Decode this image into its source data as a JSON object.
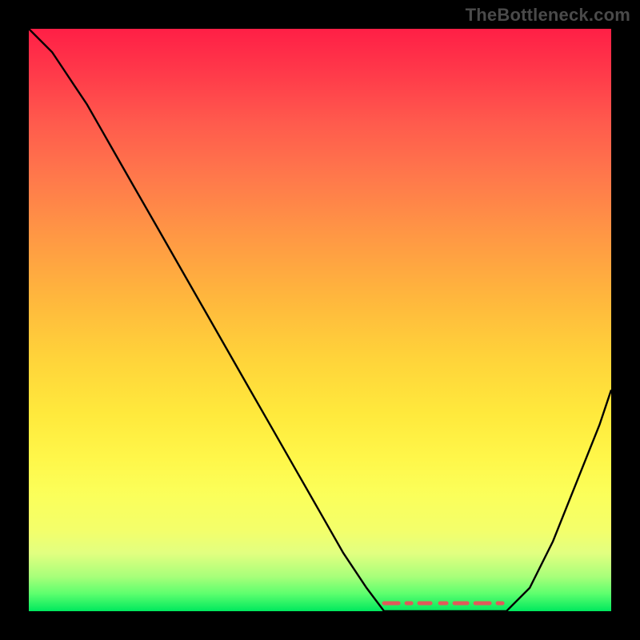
{
  "watermark": "TheBottleneck.com",
  "colors": {
    "page_bg": "#000000",
    "curve": "#000000",
    "dash": "#e05a5a",
    "gradient_top": "#ff1f46",
    "gradient_bottom": "#00e85e"
  },
  "chart_data": {
    "type": "line",
    "title": "",
    "xlabel": "",
    "ylabel": "",
    "xlim": [
      0,
      1
    ],
    "ylim": [
      0,
      1
    ],
    "x": [
      0.0,
      0.02,
      0.04,
      0.06,
      0.08,
      0.1,
      0.14,
      0.18,
      0.22,
      0.26,
      0.3,
      0.34,
      0.38,
      0.42,
      0.46,
      0.5,
      0.54,
      0.58,
      0.61,
      0.66,
      0.7,
      0.74,
      0.78,
      0.82,
      0.86,
      0.9,
      0.94,
      0.98,
      1.0
    ],
    "values": [
      1.0,
      0.98,
      0.96,
      0.93,
      0.9,
      0.87,
      0.8,
      0.73,
      0.66,
      0.59,
      0.52,
      0.45,
      0.38,
      0.31,
      0.24,
      0.17,
      0.1,
      0.04,
      0.0,
      0.0,
      0.0,
      0.0,
      0.0,
      0.0,
      0.04,
      0.12,
      0.22,
      0.32,
      0.38
    ],
    "optimum_band": {
      "x_start": 0.61,
      "x_end": 0.82,
      "y": 0.0
    },
    "interpretation": "Curve depicts mismatch; valley near x≈0.6–0.82 reaches y≈0 indicating optimal pairing; right side rises again."
  }
}
